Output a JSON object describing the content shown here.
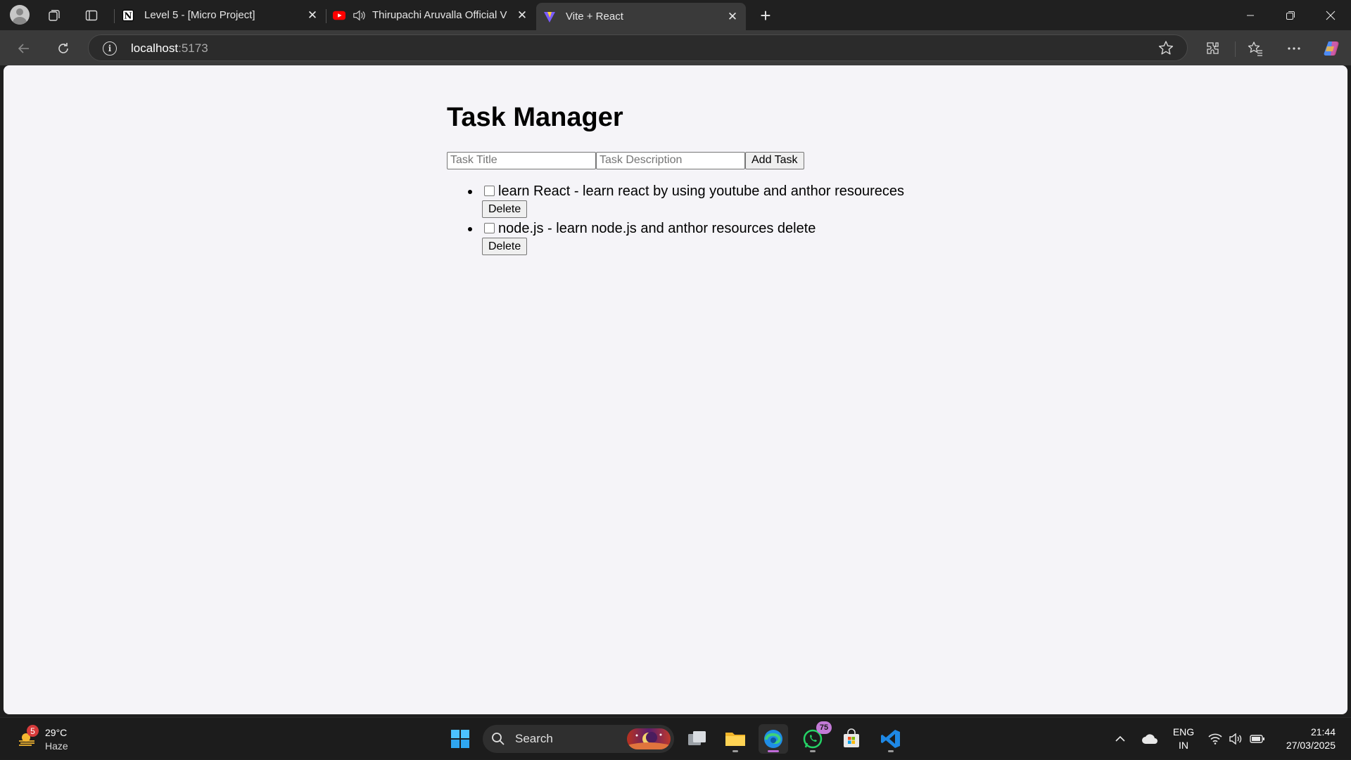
{
  "browser": {
    "tabs": [
      {
        "title": "Level 5 - [Micro Project]",
        "icon": "notion-icon",
        "active": false
      },
      {
        "title": "Thirupachi Aruvalla Official V",
        "icon": "youtube-icon",
        "active": false
      },
      {
        "title": "Vite + React",
        "icon": "vite-icon",
        "active": true
      }
    ],
    "url_host": "localhost",
    "url_port": ":5173"
  },
  "page": {
    "title": "Task Manager",
    "title_placeholder": "Task Title",
    "description_placeholder": "Task Description",
    "add_button": "Add Task",
    "tasks": [
      {
        "text": "learn React - learn react by using youtube and anthor resoureces",
        "checked": false,
        "delete_label": "Delete"
      },
      {
        "text": "node.js - learn node.js and anthor resources delete",
        "checked": false,
        "delete_label": "Delete"
      }
    ]
  },
  "taskbar": {
    "weather_temp": "29°C",
    "weather_condition": "Haze",
    "weather_badge": "5",
    "search_label": "Search",
    "whatsapp_badge": "75",
    "lang_primary": "ENG",
    "lang_secondary": "IN",
    "time": "21:44",
    "date": "27/03/2025"
  }
}
